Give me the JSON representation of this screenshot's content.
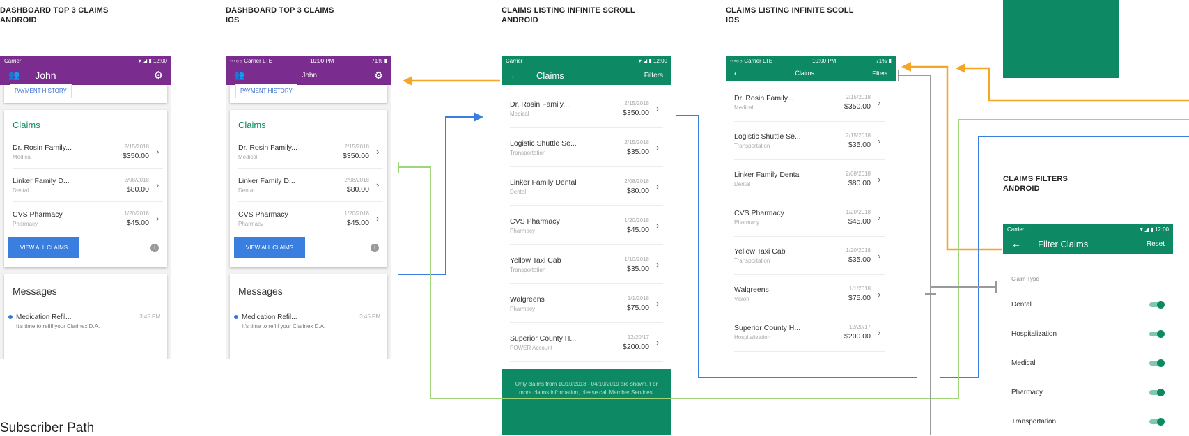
{
  "labels": {
    "dash_android": [
      "DASHBOARD TOP 3 CLAIMS",
      "ANDROID"
    ],
    "dash_ios": [
      "DASHBOARD TOP 3 CLAIMS",
      "IOS"
    ],
    "list_android": [
      "CLAIMS LISTING INFINITE SCROLL",
      "ANDROID"
    ],
    "list_ios": [
      "CLAIMS LISTING INFINITE SCOLL",
      "IOS"
    ],
    "filters_android": [
      "CLAIMS FILTERS",
      "ANDROID"
    ]
  },
  "footer_title": "Subscriber Path",
  "dashboard": {
    "user_name": "John",
    "payment_history": "PAYMENT HISTORY",
    "claims_title": "Claims",
    "claims": [
      {
        "name": "Dr. Rosin Family...",
        "type": "Medical",
        "date": "2/15/2018",
        "amount": "$350.00"
      },
      {
        "name": "Linker Family D...",
        "type": "Dental",
        "date": "2/08/2018",
        "amount": "$80.00"
      },
      {
        "name": "CVS Pharmacy",
        "type": "Pharmacy",
        "date": "1/20/2018",
        "amount": "$45.00"
      }
    ],
    "view_all": "VIEW ALL CLAIMS",
    "messages_title": "Messages",
    "message": {
      "title": "Medication Refil...",
      "time": "3:45 PM",
      "preview": "It's time to refill your Clarinex D.A."
    }
  },
  "status": {
    "android_carrier": "Carrier",
    "android_time": "12:00",
    "ios_carrier": "•••○○ Carrier LTE",
    "ios_time": "10:00 PM",
    "ios_battery": "71%"
  },
  "listing": {
    "title": "Claims",
    "filters": "Filters",
    "claims_android": [
      {
        "name": "Dr. Rosin Family...",
        "type": "Medical",
        "date": "2/15/2018",
        "amount": "$350.00"
      },
      {
        "name": "Logistic Shuttle Se...",
        "type": "Transportation",
        "date": "2/15/2018",
        "amount": "$35.00"
      },
      {
        "name": "Linker Family Dental",
        "type": "Dental",
        "date": "2/08/2018",
        "amount": "$80.00"
      },
      {
        "name": "CVS Pharmacy",
        "type": "Pharmacy",
        "date": "1/20/2018",
        "amount": "$45.00"
      },
      {
        "name": "Yellow Taxi Cab",
        "type": "Transportation",
        "date": "1/10/2018",
        "amount": "$35.00"
      },
      {
        "name": "Walgreens",
        "type": "Pharmacy",
        "date": "1/1/2018",
        "amount": "$75.00"
      },
      {
        "name": "Superior County H...",
        "type": "POWER Account",
        "date": "12/20/17",
        "amount": "$200.00"
      }
    ],
    "claims_ios": [
      {
        "name": "Dr. Rosin Family...",
        "type": "Medical",
        "date": "2/15/2018",
        "amount": "$350.00"
      },
      {
        "name": "Logistic Shuttle Se...",
        "type": "Transportation",
        "date": "2/15/2018",
        "amount": "$35.00"
      },
      {
        "name": "Linker Family Dental",
        "type": "Dental",
        "date": "2/08/2018",
        "amount": "$80.00"
      },
      {
        "name": "CVS Pharmacy",
        "type": "Pharmacy",
        "date": "1/20/2018",
        "amount": "$45.00"
      },
      {
        "name": "Yellow Taxi Cab",
        "type": "Transportation",
        "date": "1/20/2018",
        "amount": "$35.00"
      },
      {
        "name": "Walgreens",
        "type": "Vision",
        "date": "1/1/2018",
        "amount": "$75.00"
      },
      {
        "name": "Superior County H...",
        "type": "Hospitalization",
        "date": "12/20/17",
        "amount": "$200.00"
      }
    ],
    "notice": "Only claims from 10/10/2018 - 04/10/2019 are shown. For more claims information, please call Member Services."
  },
  "filters": {
    "title": "Filter Claims",
    "reset": "Reset",
    "section": "Claim Type",
    "types": [
      "Dental",
      "Hospitalization",
      "Medical",
      "Pharmacy",
      "Transportation"
    ],
    "enabled": [
      true,
      true,
      true,
      true,
      true
    ]
  },
  "colors": {
    "purple": "#7b2c8f",
    "green": "#0d8a64",
    "blue": "#3a7ee0",
    "orange": "#f5a623",
    "lightgreen": "#9fd67a",
    "gray": "#8a8a8a"
  }
}
